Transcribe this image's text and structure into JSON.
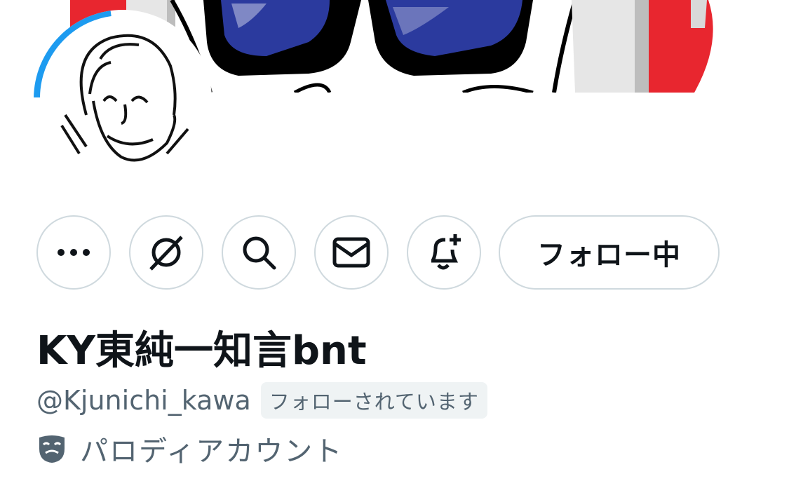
{
  "profile": {
    "display_name": "KY東純一知言bnt",
    "handle": "@Kjunichi_kawa",
    "follows_you_badge": "フォローされています",
    "account_label": "パロディアカウント"
  },
  "actions": {
    "more_icon": "more-icon",
    "grok_icon": "grok-icon",
    "search_icon": "search-icon",
    "message_icon": "envelope-icon",
    "notify_icon": "bell-plus-icon",
    "follow_button_label": "フォロー中"
  },
  "colors": {
    "text_primary": "#0f1419",
    "text_secondary": "#536471",
    "border": "#cfd9de",
    "badge_bg": "#eff3f4",
    "banner_red": "#e8262f",
    "banner_blue": "#2b3a9e",
    "avatar_ring": "#1d9bf0"
  }
}
